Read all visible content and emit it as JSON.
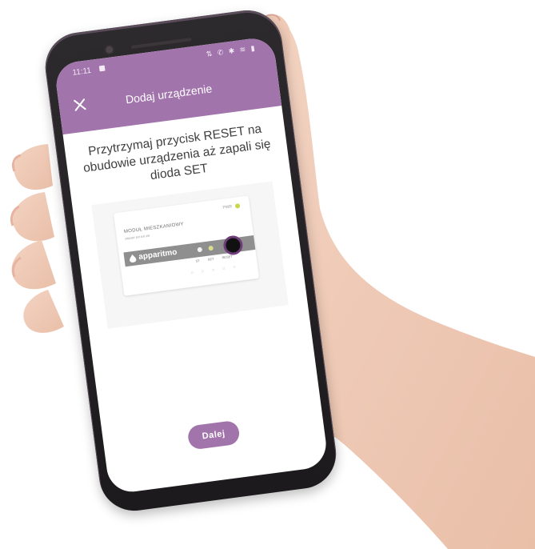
{
  "status_bar": {
    "time": "11:11",
    "icons_text": "⇅ ✆ ✱ ≋ ▮"
  },
  "header": {
    "title": "Dodaj urządzenie",
    "close_icon": "close-icon"
  },
  "instruction": "Przytrzymaj przycisk RESET na obudowie urządzenia aż zapali się dioda SET",
  "device_illustration": {
    "module_name": "MODUŁ MIESZKANIOWY",
    "module_sub": "##### ## ## ##",
    "pwr_label": "PWR",
    "brand": "apparitmo",
    "led_labels": [
      "ST",
      "SET",
      "RESET"
    ],
    "dots": "○ ○ ○ ○ ○"
  },
  "next_button_label": "Dalej",
  "colors": {
    "accent": "#a274ac",
    "phone_frame": "#2c2a2c",
    "reset_ring": "#6f3d7a"
  }
}
